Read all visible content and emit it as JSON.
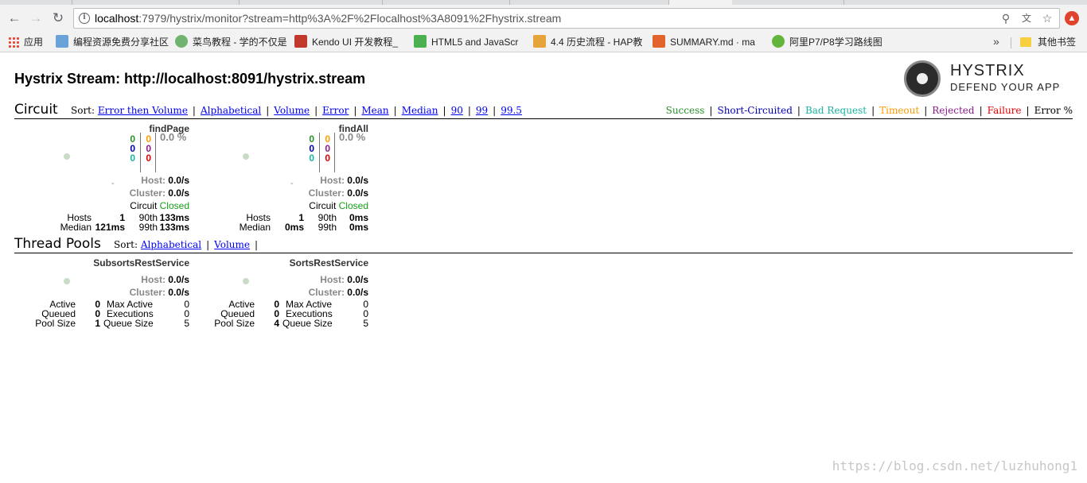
{
  "browser": {
    "url_host": "localhost",
    "url_rest": ":7979/hystrix/monitor?stream=http%3A%2F%2Flocalhost%3A8091%2Fhystrix.stream",
    "bookmarks": [
      {
        "label": "应用",
        "color": "#ea4335"
      },
      {
        "label": "编程资源免费分享社区",
        "color": "#6aa3d8"
      },
      {
        "label": "菜鸟教程 - 学的不仅是",
        "color": "#6fb36f"
      },
      {
        "label": "Kendo UI 开发教程_",
        "color": "#c0392b"
      },
      {
        "label": "HTML5 and JavaScr",
        "color": "#4caf50"
      },
      {
        "label": "4.4 历史流程 - HAP教",
        "color": "#e5a33a"
      },
      {
        "label": "SUMMARY.md · ma",
        "color": "#e2632b"
      },
      {
        "label": "阿里P7/P8学习路线图",
        "color": "#62b53c"
      }
    ],
    "more_label": "»",
    "other_bookmarks": "其他书签"
  },
  "dashboard": {
    "title": "Hystrix Stream: http://localhost:8091/hystrix.stream",
    "logo_name": "HYSTRIX",
    "logo_tagline": "DEFEND YOUR APP",
    "circuit": {
      "heading": "Circuit",
      "sort_label": "Sort:",
      "sort_links": [
        "Error then Volume",
        "Alphabetical",
        "Volume",
        "Error",
        "Mean",
        "Median",
        "90",
        "99",
        "99.5"
      ],
      "legend": [
        {
          "label": "Success",
          "color": "#2a8f2a"
        },
        {
          "label": "Short-Circuited",
          "color": "#0000b3"
        },
        {
          "label": "Bad Request",
          "color": "#19b3a0"
        },
        {
          "label": "Timeout",
          "color": "#ff9900"
        },
        {
          "label": "Rejected",
          "color": "#8a1a8a"
        },
        {
          "label": "Failure",
          "color": "#e00000"
        },
        {
          "label": "Error %",
          "color": "#000000"
        }
      ],
      "cards": [
        {
          "name": "findPage",
          "success": "0",
          "short_circuited": "0",
          "bad_request": "0",
          "timeout": "0",
          "rejected": "0",
          "failure": "0",
          "error_rate": "0.0 %",
          "dash": "-",
          "host_label": "Host:",
          "host_rate": "0.0/s",
          "cluster_label": "Cluster:",
          "cluster_rate": "0.0/s",
          "circuit_label": "Circuit",
          "circuit_status": "Closed",
          "hosts_label": "Hosts",
          "hosts": "1",
          "median_label": "Median",
          "median": "121ms",
          "p90_label": "90th",
          "p90": "133ms",
          "p99_label": "99th",
          "p99": "133ms"
        },
        {
          "name": "findAll",
          "success": "0",
          "short_circuited": "0",
          "bad_request": "0",
          "timeout": "0",
          "rejected": "0",
          "failure": "0",
          "error_rate": "0.0 %",
          "dash": "-",
          "host_label": "Host:",
          "host_rate": "0.0/s",
          "cluster_label": "Cluster:",
          "cluster_rate": "0.0/s",
          "circuit_label": "Circuit",
          "circuit_status": "Closed",
          "hosts_label": "Hosts",
          "hosts": "1",
          "median_label": "Median",
          "median": "0ms",
          "p90_label": "90th",
          "p90": "0ms",
          "p99_label": "99th",
          "p99": "0ms"
        }
      ]
    },
    "thread_pools": {
      "heading": "Thread Pools",
      "sort_label": "Sort:",
      "sort_links": [
        "Alphabetical",
        "Volume"
      ],
      "pools": [
        {
          "name": "SubsortsRestService",
          "host_label": "Host:",
          "host_rate": "0.0/s",
          "cluster_label": "Cluster:",
          "cluster_rate": "0.0/s",
          "active_label": "Active",
          "active": "0",
          "queued_label": "Queued",
          "queued": "0",
          "pool_size_label": "Pool Size",
          "pool_size": "1",
          "max_active_label": "Max Active",
          "max_active": "0",
          "executions_label": "Executions",
          "executions": "0",
          "queue_size_label": "Queue Size",
          "queue_size": "5"
        },
        {
          "name": "SortsRestService",
          "host_label": "Host:",
          "host_rate": "0.0/s",
          "cluster_label": "Cluster:",
          "cluster_rate": "0.0/s",
          "active_label": "Active",
          "active": "0",
          "queued_label": "Queued",
          "queued": "0",
          "pool_size_label": "Pool Size",
          "pool_size": "4",
          "max_active_label": "Max Active",
          "max_active": "0",
          "executions_label": "Executions",
          "executions": "0",
          "queue_size_label": "Queue Size",
          "queue_size": "5"
        }
      ]
    },
    "watermark": "https://blog.csdn.net/luzhuhong1"
  }
}
